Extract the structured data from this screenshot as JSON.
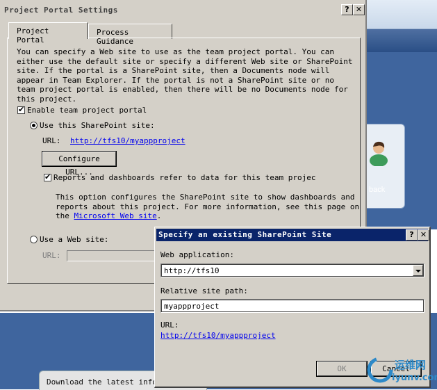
{
  "main_dialog": {
    "title": "Project Portal Settings",
    "help_button": "?",
    "close_button": "✕",
    "tabs": [
      {
        "label": "Project Portal",
        "active": true
      },
      {
        "label": "Process Guidance",
        "active": false
      }
    ],
    "description": "You can specify a Web site to use as the team project portal. You can either use the default site or specify a different Web site or SharePoint site. If the portal is a SharePoint site, then a Documents node will appear in Team Explorer. If the portal is not a SharePoint site or no team project portal is enabled, then there will be no Documents node for this project.",
    "enable_portal": {
      "label": "Enable team project portal",
      "checked": true
    },
    "use_sharepoint": {
      "label": "Use this SharePoint site:",
      "selected": true
    },
    "url_label": "URL:",
    "url_value": "http://tfs10/myappproject",
    "configure_button": "Configure URL...",
    "reports_checkbox": {
      "label": "Reports and dashboards refer to data for this team projec",
      "checked": true
    },
    "info_text": "This option configures the SharePoint site to show dashboards and reports about this project. For more information, see this page on the",
    "info_link": "Microsoft Web site",
    "info_suffix": ".",
    "use_web_site": {
      "label": "Use a Web site:",
      "selected": false
    },
    "web_url_label": "URL:",
    "web_url_value": ""
  },
  "sharepoint_dialog": {
    "title": "Specify an existing SharePoint Site",
    "help_button": "?",
    "close_button": "✕",
    "web_app_label": "Web application:",
    "web_app_value": "http://tfs10",
    "relative_path_label": "Relative site path:",
    "relative_path_value": "myappproject",
    "url_label": "URL:",
    "url_value": "http://tfs10/myappproject",
    "ok_button": "OK",
    "cancel_button": "Cancel"
  },
  "background": {
    "card_label": "back",
    "news_text": "Download the latest inform"
  },
  "watermark": {
    "text1": "运维网",
    "text2": "iyunv.com"
  },
  "colors": {
    "dialog_face": "#d4d0c8",
    "titlebar_active": "#0a246a",
    "link": "#0000ee",
    "bg_blue": "#3f659e"
  }
}
